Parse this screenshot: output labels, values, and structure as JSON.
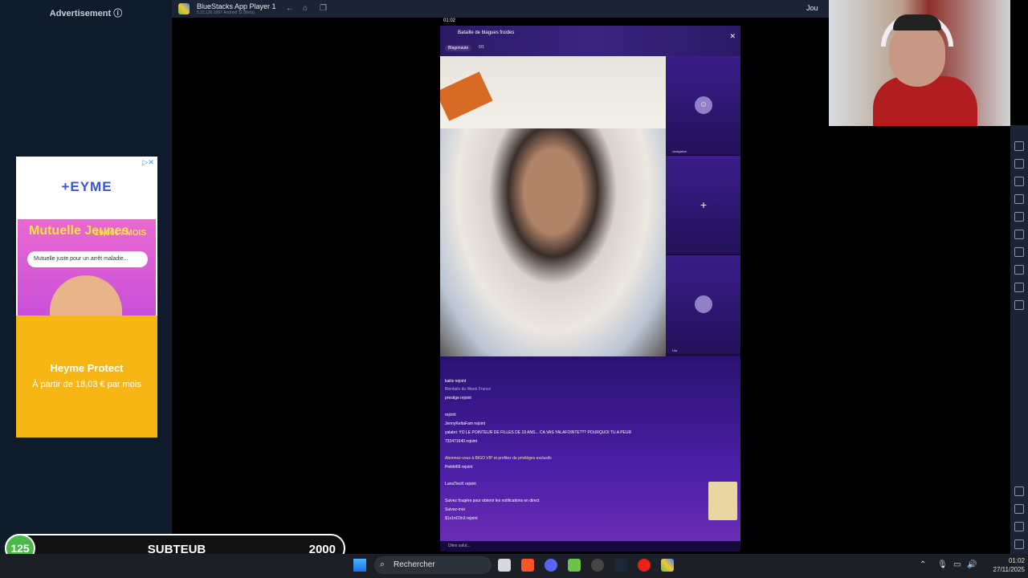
{
  "ad": {
    "label": "Advertisement ⓘ",
    "brand": "+EYME",
    "promo_title": "Mutuelle Jeunes",
    "promo_price": "19,66€ / MOIS",
    "search_placeholder": "Mutuelle juste pour un arrêt maladie...",
    "headline": "Heyme Protect",
    "subline": "À partir de 18,03 € par mois"
  },
  "bluestacks": {
    "title": "BlueStacks App Player 1",
    "version": "5.22.130.1007 Android 11 (Beta)",
    "right_label": "Jou"
  },
  "phone": {
    "status_time": "01:02",
    "room_title": "Bataille de blagues froides",
    "room_tag": "Blagonaute",
    "room_count": "0/1",
    "seat_names": [
      "chatglaive",
      "",
      "Lila"
    ],
    "chat_lines": [
      "kaiiis rejoint",
      "Bienfaits du Week France",
      "prestige rejoint",
      "rejoint",
      "JennyKettaFam rejoint",
      "yalabri: YO LE POINTEUR DE FILLES DE 19 ANS... CA VAS YALAFOINTE??? POURQUOI TU A PEUR",
      "733471640 rejoint",
      "Abonnez-vous à BIGO VIP et profitez de privilèges exclusifs",
      "Pelélé69 rejoint",
      "LunaTiecK rejoint",
      "Suivez fougère pour obtenir les notifications en direct",
      "Suivez-moi",
      "$1x1nC0n3 rejoint"
    ],
    "input_placeholder": "Dites salut..."
  },
  "goal": {
    "current": "125",
    "name": "SUBTEUB",
    "target": "2000"
  },
  "taskbar": {
    "search_label": "Rechercher",
    "time": "01:02",
    "date": "27/11/2025"
  }
}
